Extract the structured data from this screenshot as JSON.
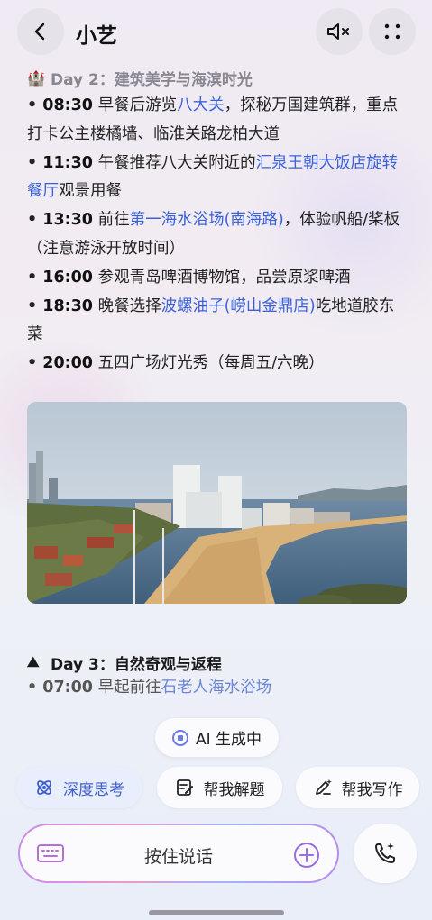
{
  "header": {
    "title": "小艺"
  },
  "day2": {
    "emoji": "🏰",
    "heading": "Day 2：建筑美学与海滨时光",
    "items": [
      {
        "time": "08:30",
        "pre": "早餐后游览",
        "link": "八大关",
        "post": "，探秘万国建筑群，重点打卡公主楼橘墙、临淮关路龙柏大道"
      },
      {
        "time": "11:30",
        "pre": "午餐推荐八大关附近的",
        "link": "汇泉王朝大饭店旋转餐厅",
        "post": "观景用餐"
      },
      {
        "time": "13:30",
        "pre": "前往",
        "link": "第一海水浴场(南海路)",
        "post": "，体验帆船/桨板（注意游泳开放时间）"
      },
      {
        "time": "16:00",
        "pre": "参观青岛啤酒博物馆，品尝原浆啤酒",
        "link": "",
        "post": ""
      },
      {
        "time": "18:30",
        "pre": "晚餐选择",
        "link": "波螺油子(崂山金鼎店)",
        "post": "吃地道胶东菜"
      },
      {
        "time": "20:00",
        "pre": "五四广场灯光秀（每周五/六晚）",
        "link": "",
        "post": ""
      }
    ]
  },
  "day3": {
    "emoji": "⛰",
    "heading": "Day 3：自然奇观与返程",
    "items": [
      {
        "time": "07:00",
        "pre": "早起前往",
        "link": "石老人海水浴场",
        "post": ""
      }
    ]
  },
  "status": {
    "label": "AI 生成中"
  },
  "chips": {
    "deep": "深度思考",
    "solve": "帮我解题",
    "write": "帮我写作"
  },
  "input": {
    "label": "按住说话"
  },
  "colors": {
    "link": "#3a62d8",
    "accent": "#6b7be6",
    "chip_active_bg": "#e8eefc"
  }
}
